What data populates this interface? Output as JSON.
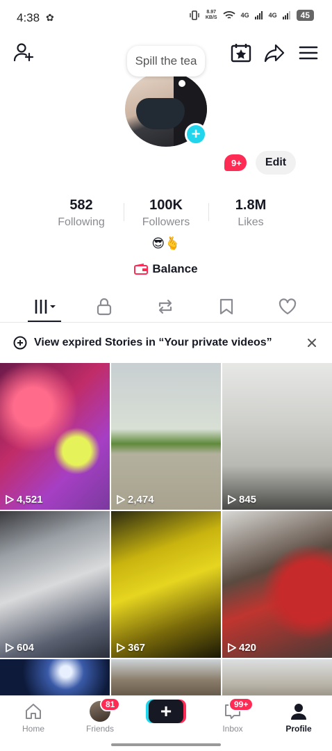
{
  "status_bar": {
    "time": "4:38",
    "speed_value": "8.97",
    "speed_unit": "KB/S",
    "signal_1": "4G",
    "signal_2": "4G",
    "battery": "45"
  },
  "header": {
    "icons": [
      "add-friend-icon",
      "calendar-star-icon",
      "share-icon",
      "menu-icon"
    ]
  },
  "profile": {
    "note_bubble": "Spill the tea",
    "notification_badge": "9+",
    "edit_label": "Edit",
    "bio": "😎🫰",
    "balance_label": "Balance"
  },
  "stats": [
    {
      "value": "582",
      "label": "Following"
    },
    {
      "value": "100K",
      "label": "Followers"
    },
    {
      "value": "1.8M",
      "label": "Likes"
    }
  ],
  "tabs": [
    "videos",
    "private",
    "reposts",
    "favorites",
    "liked"
  ],
  "notice": {
    "text": "View expired Stories in “Your private videos”"
  },
  "videos": [
    {
      "views": "4,521"
    },
    {
      "views": "2,474"
    },
    {
      "views": "845"
    },
    {
      "views": "604"
    },
    {
      "views": "367"
    },
    {
      "views": "420"
    },
    {
      "views": ""
    },
    {
      "views": ""
    },
    {
      "views": ""
    }
  ],
  "bottom_nav": {
    "home": "Home",
    "friends": "Friends",
    "friends_badge": "81",
    "inbox": "Inbox",
    "inbox_badge": "99+",
    "profile": "Profile"
  },
  "colors": {
    "accent_red": "#fe2c55",
    "accent_cyan": "#20d5ec",
    "text_primary": "#161823",
    "text_secondary": "#8a8b91"
  }
}
